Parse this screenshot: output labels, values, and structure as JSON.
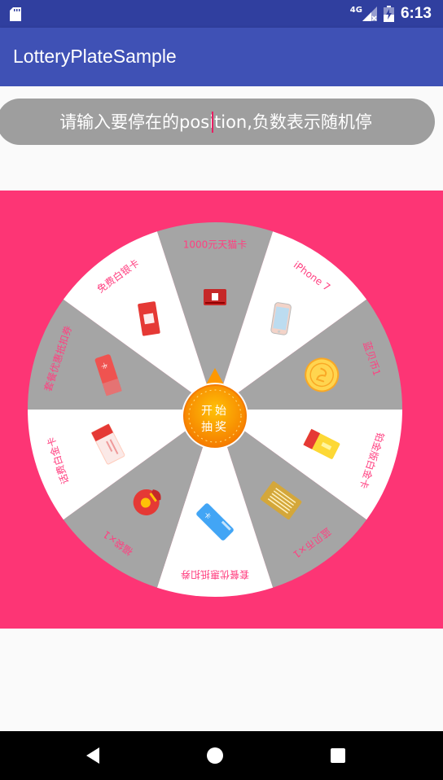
{
  "status_bar": {
    "network": "4G",
    "time": "6:13"
  },
  "app_bar": {
    "title": "LotteryPlateSample"
  },
  "position_input": {
    "placeholder": "请输入要停在的position,负数表示随机停",
    "value": ""
  },
  "wheel": {
    "start_button": {
      "line1": "开始",
      "line2": "抽奖"
    },
    "prizes": [
      {
        "label": "1000元天猫卡",
        "icon": "tmall-card-icon"
      },
      {
        "label": "iPhone 7",
        "icon": "iphone-icon"
      },
      {
        "label": "蓝贝币1",
        "icon": "gold-coin-icon"
      },
      {
        "label": "铂金版白金卡",
        "icon": "platinum-card-icon"
      },
      {
        "label": "蓝贝币×1",
        "icon": "gold-bar-card-icon"
      },
      {
        "label": "套餐优惠抵扣券",
        "icon": "blue-coupon-icon"
      },
      {
        "label": "福袋×1",
        "icon": "lucky-bag-icon"
      },
      {
        "label": "话费白金卡",
        "icon": "white-card-icon"
      },
      {
        "label": "套餐优惠抵扣券",
        "icon": "red-coupon-icon"
      },
      {
        "label": "免费白银卡",
        "icon": "silver-card-icon"
      }
    ]
  },
  "colors": {
    "primary": "#3f51b5",
    "primary_dark": "#303f9f",
    "plate_bg": "#fd3575",
    "sector_gray": "#a5a5a5",
    "label_pink": "#ff4081"
  }
}
